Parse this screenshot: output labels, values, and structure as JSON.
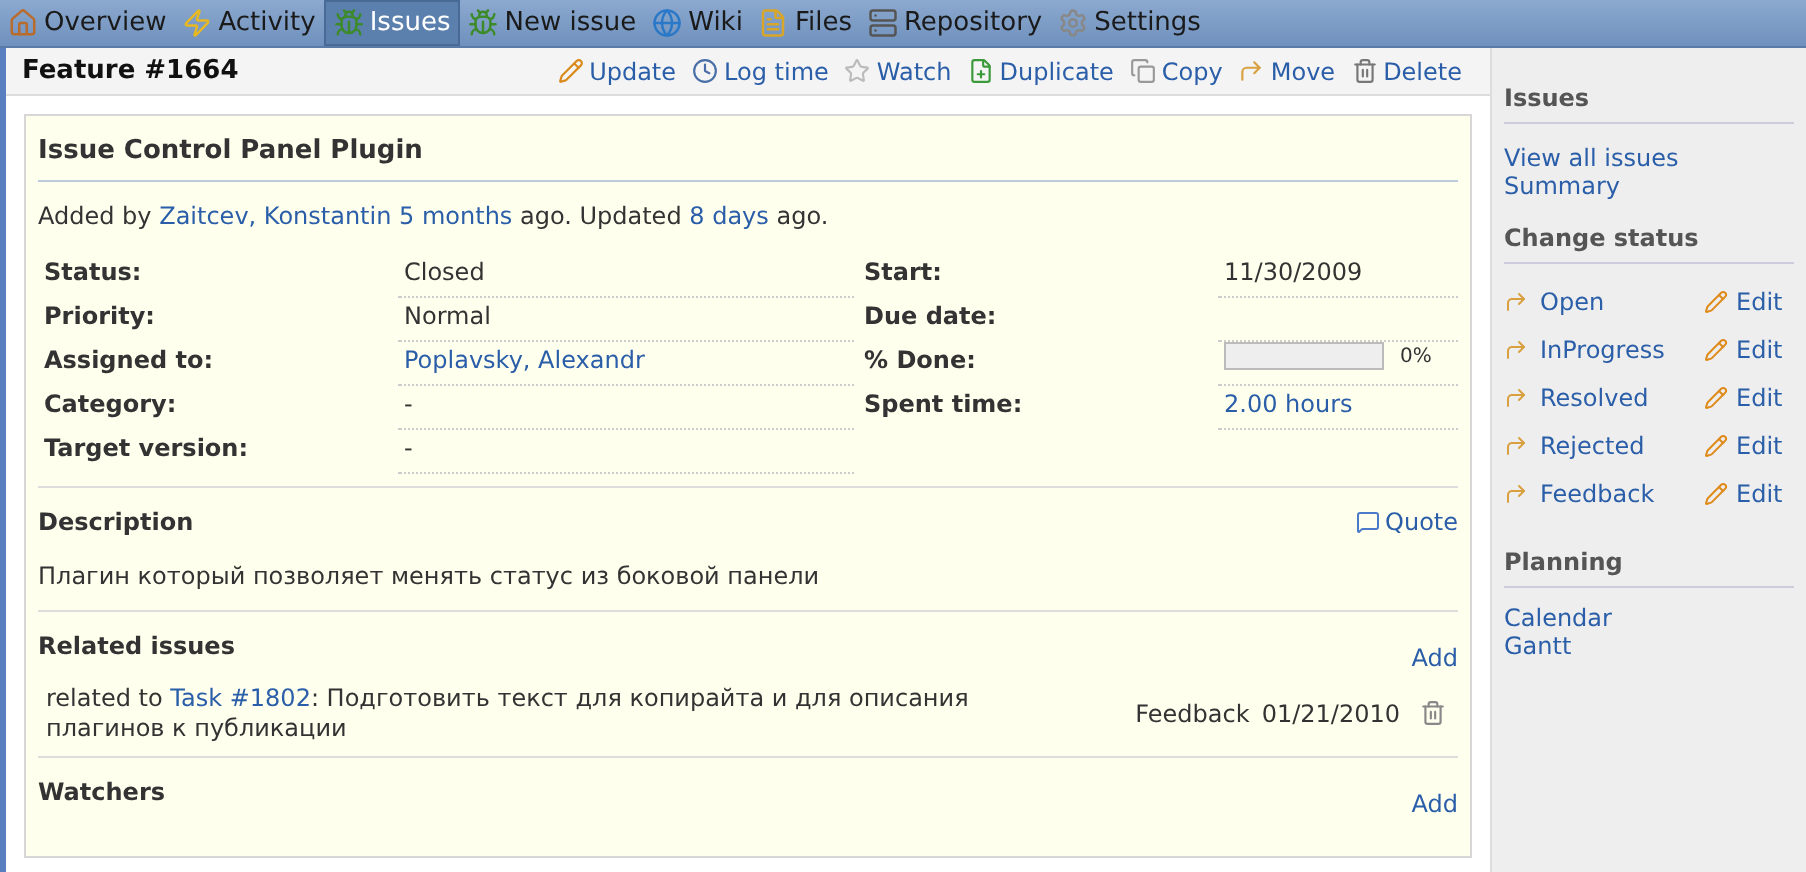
{
  "main_menu": [
    {
      "label": "Overview",
      "selected": false
    },
    {
      "label": "Activity",
      "selected": false
    },
    {
      "label": "Issues",
      "selected": true
    },
    {
      "label": "New issue",
      "selected": false
    },
    {
      "label": "Wiki",
      "selected": false
    },
    {
      "label": "Files",
      "selected": false
    },
    {
      "label": "Repository",
      "selected": false
    },
    {
      "label": "Settings",
      "selected": false
    }
  ],
  "issue_header": {
    "title": "Feature #1664",
    "actions": [
      "Update",
      "Log time",
      "Watch",
      "Duplicate",
      "Copy",
      "Move",
      "Delete"
    ]
  },
  "issue": {
    "subject": "Issue Control Panel Plugin",
    "author_line": [
      {
        "kind": "text",
        "text": "Added by "
      },
      {
        "kind": "link",
        "text": "Zaitcev, Konstantin"
      },
      {
        "kind": "link",
        "text": "5 months"
      },
      {
        "kind": "text",
        "text": " ago. Updated "
      },
      {
        "kind": "link",
        "text": "8 days"
      },
      {
        "kind": "text",
        "text": " ago."
      }
    ],
    "attributes_left": [
      {
        "label": "Status:",
        "kind": "text",
        "value": "Closed"
      },
      {
        "label": "Priority:",
        "kind": "text",
        "value": "Normal"
      },
      {
        "label": "Assigned to:",
        "kind": "link",
        "value": "Poplavsky, Alexandr"
      },
      {
        "label": "Category:",
        "kind": "text",
        "value": "-"
      },
      {
        "label": "Target version:",
        "kind": "text",
        "value": "-"
      }
    ],
    "attributes_right": [
      {
        "label": "Start:",
        "kind": "text",
        "value": "11/30/2009"
      },
      {
        "label": "Due date:",
        "kind": "empty"
      },
      {
        "label": "% Done:",
        "kind": "progress",
        "level": 0,
        "reading": "0%"
      },
      {
        "label": "Spent time:",
        "kind": "link",
        "value": "2.00 hours"
      }
    ],
    "description": {
      "heading": "Description",
      "quote": "Quote",
      "text": "Плагин который позволяет менять статус из боковой панели"
    },
    "related": {
      "heading": "Related issues",
      "add": "Add",
      "items": [
        {
          "relation": "related to",
          "link": "Task #1802",
          "subject": ": Подготовить текст для копирайта и для описания плагинов к публикации",
          "status": "Feedback",
          "date": "01/21/2010"
        }
      ]
    },
    "watchers": {
      "heading": "Watchers",
      "add": "Add"
    }
  },
  "sidebar": {
    "issues": {
      "heading": "Issues",
      "links": [
        "View all issues",
        "Summary"
      ]
    },
    "change_status": {
      "heading": "Change status",
      "items": [
        {
          "status": "Open",
          "edit": "Edit"
        },
        {
          "status": "InProgress",
          "edit": "Edit"
        },
        {
          "status": "Resolved",
          "edit": "Edit"
        },
        {
          "status": "Rejected",
          "edit": "Edit"
        },
        {
          "status": "Feedback",
          "edit": "Edit"
        }
      ]
    },
    "planning": {
      "heading": "Planning",
      "links": [
        "Calendar",
        "Gantt"
      ]
    }
  }
}
